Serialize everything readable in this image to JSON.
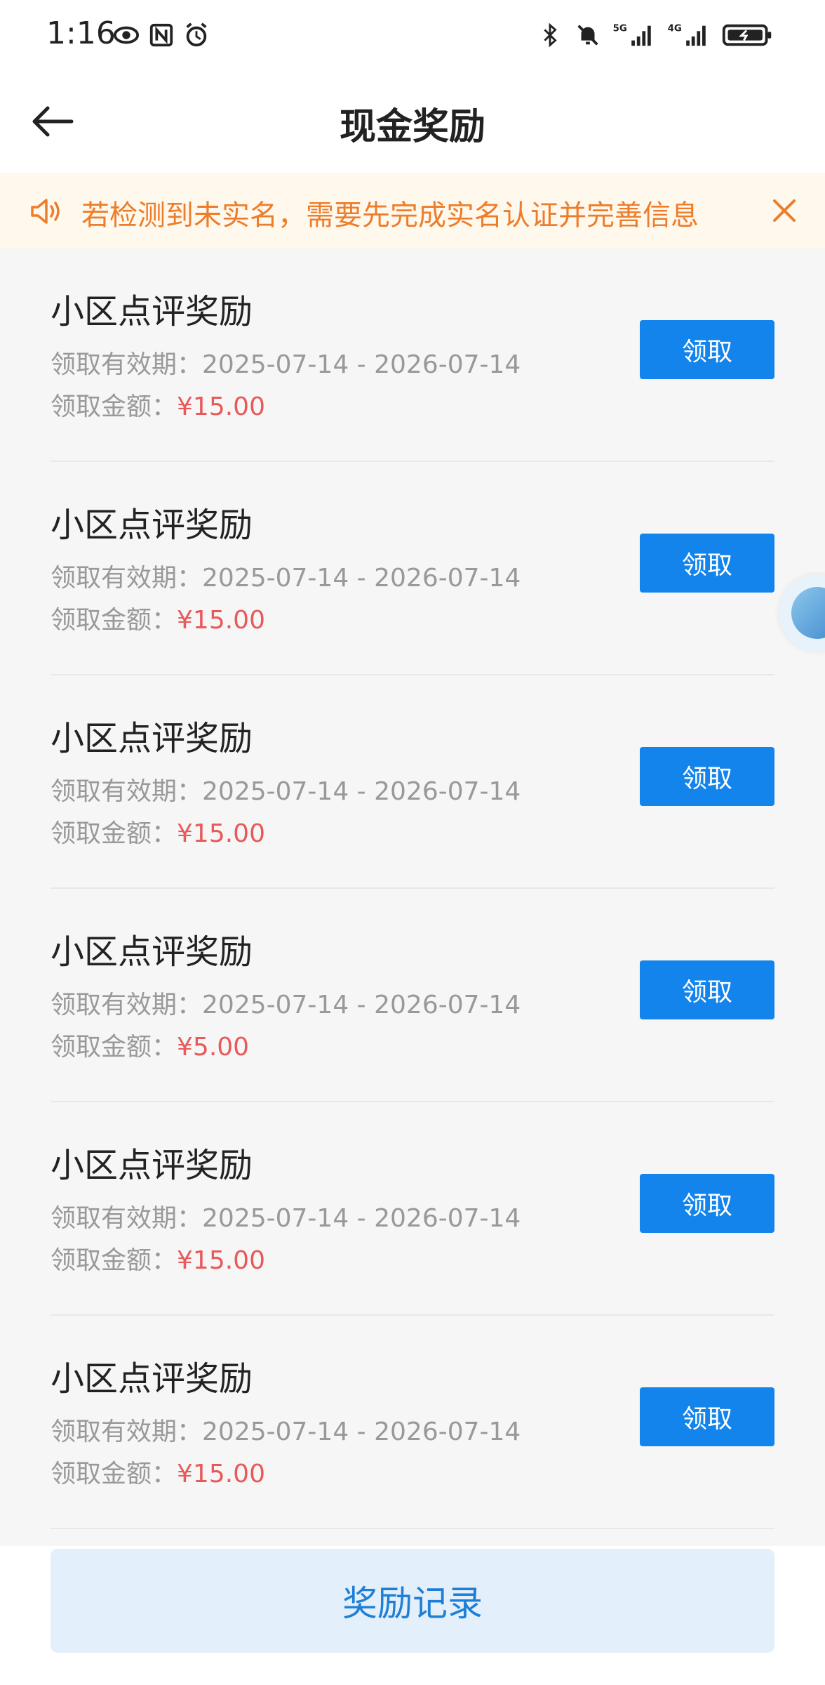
{
  "status_bar": {
    "time": "1:16",
    "network_labels": [
      "5G",
      "4G"
    ]
  },
  "header": {
    "title": "现金奖励"
  },
  "notice": {
    "text": "若检测到未实名，需要先完成实名认证并完善信息"
  },
  "rewards": [
    {
      "title": "小区点评奖励",
      "period_label": "领取有效期：",
      "period": "2025-07-14 - 2026-07-14",
      "amount_label": "领取金额：",
      "amount": "¥15.00",
      "button": "领取"
    },
    {
      "title": "小区点评奖励",
      "period_label": "领取有效期：",
      "period": "2025-07-14 - 2026-07-14",
      "amount_label": "领取金额：",
      "amount": "¥15.00",
      "button": "领取"
    },
    {
      "title": "小区点评奖励",
      "period_label": "领取有效期：",
      "period": "2025-07-14 - 2026-07-14",
      "amount_label": "领取金额：",
      "amount": "¥15.00",
      "button": "领取"
    },
    {
      "title": "小区点评奖励",
      "period_label": "领取有效期：",
      "period": "2025-07-14 - 2026-07-14",
      "amount_label": "领取金额：",
      "amount": "¥5.00",
      "button": "领取"
    },
    {
      "title": "小区点评奖励",
      "period_label": "领取有效期：",
      "period": "2025-07-14 - 2026-07-14",
      "amount_label": "领取金额：",
      "amount": "¥15.00",
      "button": "领取"
    },
    {
      "title": "小区点评奖励",
      "period_label": "领取有效期：",
      "period": "2025-07-14 - 2026-07-14",
      "amount_label": "领取金额：",
      "amount": "¥15.00",
      "button": "领取"
    }
  ],
  "footer": {
    "records_button": "奖励记录"
  },
  "colors": {
    "primary": "#1384ec",
    "notice_text": "#ee7d2b",
    "notice_bg": "#fff8ec",
    "amount": "#e85a5a",
    "records_bg": "#e3effa",
    "records_text": "#1f7fd6"
  },
  "icons": {
    "status_left": [
      "eye-icon",
      "nfc-icon",
      "alarm-icon"
    ],
    "status_right": [
      "bluetooth-icon",
      "mute-icon",
      "signal-5g-icon",
      "signal-4g-icon",
      "battery-icon"
    ],
    "back": "arrow-left-icon",
    "notice": "speaker-icon",
    "close": "close-icon"
  }
}
